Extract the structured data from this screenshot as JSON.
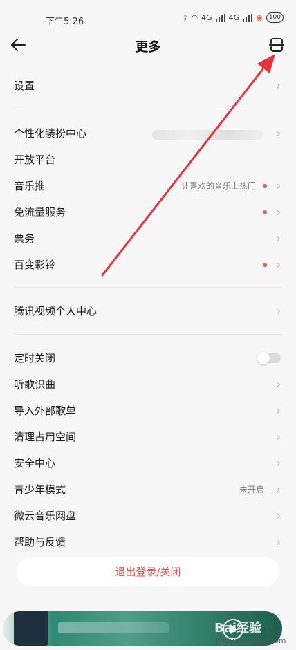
{
  "status": {
    "time": "下午5:26",
    "network1": "4G",
    "network2": "4G",
    "battery": "100"
  },
  "header": {
    "title": "更多"
  },
  "group1": [
    {
      "label": "设置"
    }
  ],
  "group2": [
    {
      "label": "个性化装扮中心",
      "hint": ""
    },
    {
      "label": "开放平台",
      "hint": ""
    },
    {
      "label": "音乐推",
      "hint": "让喜欢的音乐上热门"
    },
    {
      "label": "免流量服务",
      "hint": ""
    },
    {
      "label": "票务",
      "hint": ""
    },
    {
      "label": "百变彩铃",
      "hint": ""
    }
  ],
  "group3": [
    {
      "label": "腾讯视频个人中心"
    }
  ],
  "group4": [
    {
      "label": "定时关闭",
      "hint": ""
    },
    {
      "label": "听歌识曲",
      "hint": ""
    },
    {
      "label": "导入外部歌单",
      "hint": ""
    },
    {
      "label": "清理占用空间",
      "hint": ""
    },
    {
      "label": "安全中心",
      "hint": ""
    },
    {
      "label": "青少年模式",
      "hint": "未开启"
    },
    {
      "label": "微云音乐网盘",
      "hint": ""
    },
    {
      "label": "帮助与反馈",
      "hint": ""
    }
  ],
  "logout_label": "退出登录/关闭",
  "watermark": {
    "brand": "Bai经验",
    "url": "jingyan.baidu.com"
  },
  "colors": {
    "accent": "#e5534b",
    "arrow": "#e8313a",
    "dot": "#ef5a5a"
  }
}
